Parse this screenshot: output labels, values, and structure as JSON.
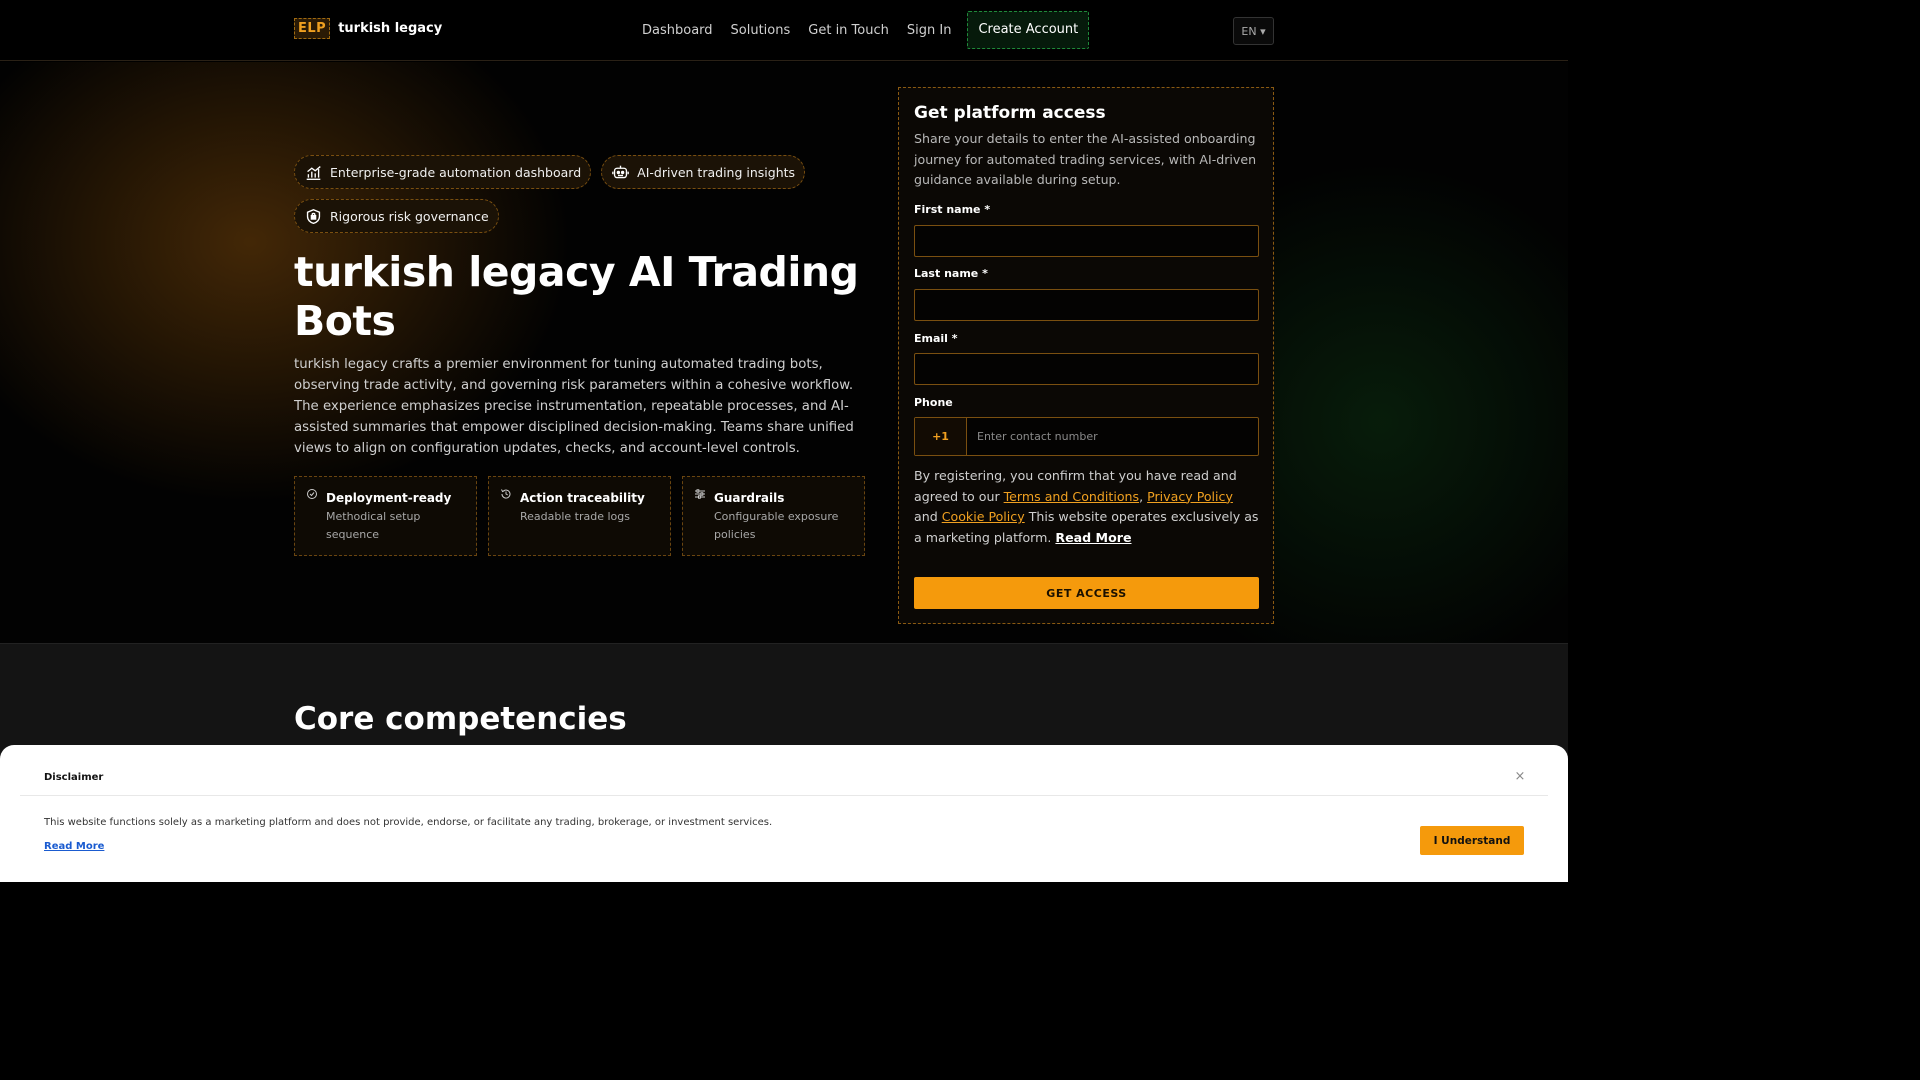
{
  "header": {
    "logo_badge": "ELP",
    "logo_name": "turkish legacy",
    "nav": [
      "Dashboard",
      "Solutions",
      "Get in Touch",
      "Sign In"
    ],
    "cta": "Create Account",
    "language": "EN ▾"
  },
  "hero": {
    "chips": [
      {
        "label": "Enterprise-grade automation dashboard",
        "icon": "chart-icon"
      },
      {
        "label": "AI-driven trading insights",
        "icon": "robot-icon"
      },
      {
        "label": "Rigorous risk governance",
        "icon": "shield-icon"
      }
    ],
    "title": "turkish legacy AI Trading Bots",
    "description": "turkish legacy crafts a premier environment for tuning automated trading bots, observing trade activity, and governing risk parameters within a cohesive workflow. The experience emphasizes precise instrumentation, repeatable processes, and AI-assisted summaries that empower disciplined decision-making. Teams share unified views to align on configuration updates, checks, and account-level controls.",
    "features": [
      {
        "title": "Deployment-ready",
        "subtitle": "Methodical setup sequence",
        "icon": "check-circle-icon"
      },
      {
        "title": "Action traceability",
        "subtitle": "Readable trade logs",
        "icon": "history-icon"
      },
      {
        "title": "Guardrails",
        "subtitle": "Configurable exposure policies",
        "icon": "sliders-icon"
      }
    ]
  },
  "form": {
    "title": "Get platform access",
    "description": "Share your details to enter the AI-assisted onboarding journey for automated trading services, with AI-driven guidance available during setup.",
    "first_name_label": "First name *",
    "first_name_value": "",
    "last_name_label": "Last name *",
    "last_name_value": "",
    "email_label": "Email *",
    "email_value": "",
    "phone_label": "Phone",
    "phone_code": "+1",
    "phone_placeholder": "Enter contact number",
    "consent_prefix": "By registering, you confirm that you have read and agreed to our ",
    "terms_link": "Terms and Conditions",
    "sep1": ", ",
    "privacy_link": "Privacy Policy",
    "sep2": " and ",
    "cookie_link": "Cookie Policy",
    "consent_suffix": " This website operates exclusively as a marketing platform. ",
    "read_more": "Read More",
    "submit": "GET ACCESS"
  },
  "lower": {
    "title": "Core competencies"
  },
  "disclaimer": {
    "title": "Disclaimer",
    "close": "×",
    "text": "This website functions solely as a marketing platform and does not provide, endorse, or facilitate any trading, brokerage, or investment services.",
    "read_more": "Read More",
    "button": "I Understand"
  },
  "colors": {
    "accent": "#f59a0c",
    "cta_green_border": "#1f8a3a",
    "link_blue": "#1a5bd0"
  }
}
